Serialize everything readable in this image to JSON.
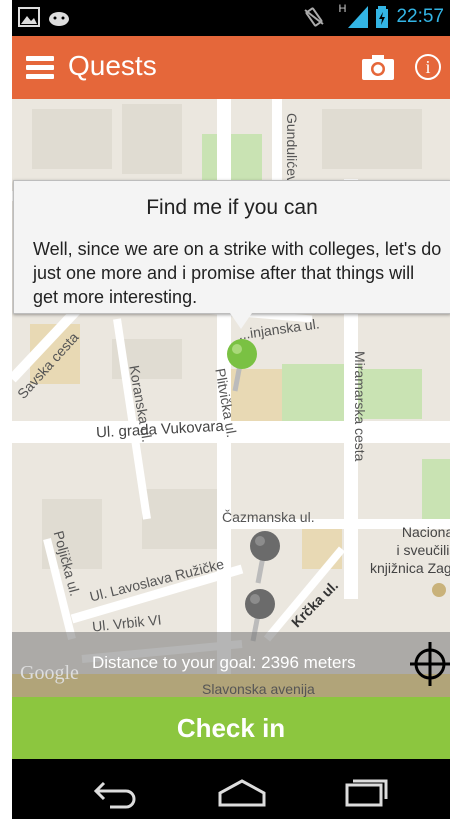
{
  "status_bar": {
    "time": "22:57",
    "network": "H",
    "left_icons": [
      "image-icon",
      "android-icon"
    ],
    "right_icons": [
      "vibrate-icon",
      "signal-icon",
      "battery-charging-icon"
    ]
  },
  "action_bar": {
    "title": "Quests",
    "background": "#e5673a",
    "icons": [
      "menu-icon",
      "camera-icon",
      "info-icon"
    ]
  },
  "popup": {
    "title": "Find me if you can",
    "body": "Well, since we are on a strike with colleges, let's do just one more and i promise after that things will get more interesting."
  },
  "map": {
    "streets": {
      "savska": "Savska cesta",
      "koranska": "Koranska ul.",
      "plitvicka": "Plitvička ul.",
      "miramarska": "Miramarska cesta",
      "vukovara": "Ul. grada Vukovara",
      "cazmanska": "Čazmanska ul.",
      "lavoslava": "Ul. Lavoslava Ružičke",
      "krcka": "Krčka ul.",
      "poljicka": "Poljička ul.",
      "vrbik": "Ul. Vrbik VI",
      "slavonska": "Slavonska avenija",
      "injanska": "...injanska ul.",
      "gunduliceva": "Gundulićev"
    },
    "poi": [
      "Nacionalna",
      "i sveučilišna",
      "knjižnica Zagreb"
    ],
    "google_logo": "Google",
    "markers": [
      {
        "name": "active-quest-marker",
        "color": "#7ac143"
      },
      {
        "name": "quest-marker",
        "color": "#6b6b6b"
      },
      {
        "name": "quest-marker",
        "color": "#6b6b6b"
      }
    ]
  },
  "distance": {
    "text": "Distance to your goal: 2396 meters"
  },
  "checkin": {
    "label": "Check in",
    "background": "#8cc63f"
  },
  "nav_bar": {
    "icons": [
      "back-icon",
      "home-icon",
      "recents-icon"
    ]
  }
}
